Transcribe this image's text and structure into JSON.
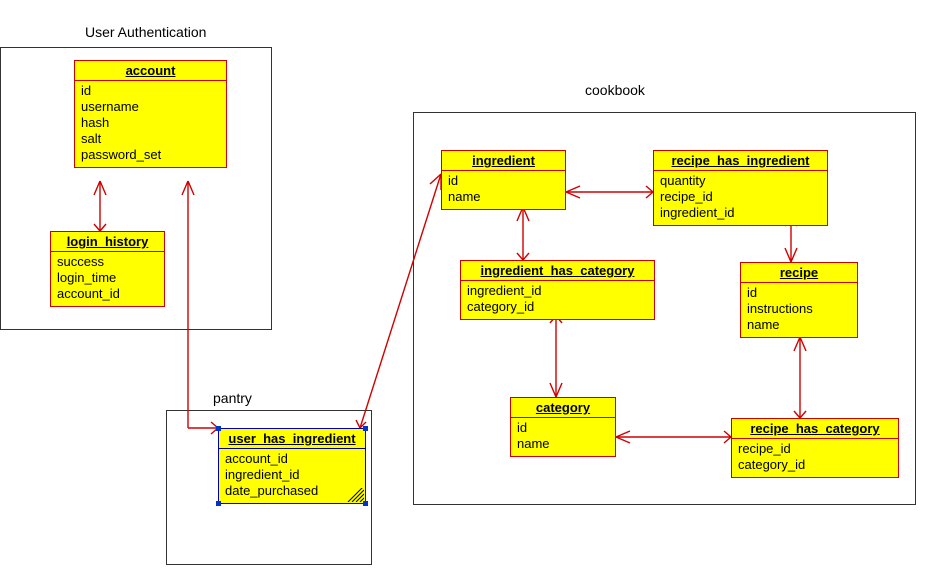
{
  "regions": {
    "auth": {
      "label": "User Authentication"
    },
    "pantry": {
      "label": "pantry"
    },
    "cookbook": {
      "label": "cookbook"
    }
  },
  "entities": {
    "account": {
      "title": "account",
      "fields": [
        "id",
        "username",
        "hash",
        "salt",
        "password_set"
      ]
    },
    "login_history": {
      "title": "login_history",
      "fields": [
        "success",
        "login_time",
        "account_id"
      ]
    },
    "user_has_ingredient": {
      "title": "user_has_ingredient",
      "fields": [
        "account_id",
        "ingredient_id",
        "date_purchased"
      ],
      "selected": true
    },
    "ingredient": {
      "title": "ingredient",
      "fields": [
        "id",
        "name"
      ]
    },
    "recipe_has_ingredient": {
      "title": "recipe_has_ingredient",
      "fields": [
        "quantity",
        "recipe_id",
        "ingredient_id"
      ]
    },
    "ingredient_has_category": {
      "title": "ingredient_has_category",
      "fields": [
        "ingredient_id",
        "category_id"
      ]
    },
    "recipe": {
      "title": "recipe",
      "fields": [
        "id",
        "instructions",
        "name"
      ]
    },
    "category": {
      "title": "category",
      "fields": [
        "id",
        "name"
      ]
    },
    "recipe_has_category": {
      "title": "recipe_has_category",
      "fields": [
        "recipe_id",
        "category_id"
      ]
    }
  },
  "relationships": [
    {
      "from": "account",
      "to": "login_history",
      "type": "one-to-many"
    },
    {
      "from": "account",
      "to": "user_has_ingredient",
      "type": "one-to-many"
    },
    {
      "from": "ingredient",
      "to": "user_has_ingredient",
      "type": "one-to-many"
    },
    {
      "from": "ingredient",
      "to": "recipe_has_ingredient",
      "type": "one-to-many"
    },
    {
      "from": "ingredient",
      "to": "ingredient_has_category",
      "type": "one-to-many"
    },
    {
      "from": "recipe",
      "to": "recipe_has_ingredient",
      "type": "one-to-many"
    },
    {
      "from": "recipe",
      "to": "recipe_has_category",
      "type": "one-to-many"
    },
    {
      "from": "category",
      "to": "ingredient_has_category",
      "type": "one-to-many"
    },
    {
      "from": "category",
      "to": "recipe_has_category",
      "type": "one-to-many"
    }
  ],
  "chart_data": {
    "type": "er-diagram",
    "entities": [
      {
        "name": "account",
        "attributes": [
          "id",
          "username",
          "hash",
          "salt",
          "password_set"
        ],
        "group": "User Authentication"
      },
      {
        "name": "login_history",
        "attributes": [
          "success",
          "login_time",
          "account_id"
        ],
        "group": "User Authentication"
      },
      {
        "name": "user_has_ingredient",
        "attributes": [
          "account_id",
          "ingredient_id",
          "date_purchased"
        ],
        "group": "pantry"
      },
      {
        "name": "ingredient",
        "attributes": [
          "id",
          "name"
        ],
        "group": "cookbook"
      },
      {
        "name": "recipe_has_ingredient",
        "attributes": [
          "quantity",
          "recipe_id",
          "ingredient_id"
        ],
        "group": "cookbook"
      },
      {
        "name": "ingredient_has_category",
        "attributes": [
          "ingredient_id",
          "category_id"
        ],
        "group": "cookbook"
      },
      {
        "name": "recipe",
        "attributes": [
          "id",
          "instructions",
          "name"
        ],
        "group": "cookbook"
      },
      {
        "name": "category",
        "attributes": [
          "id",
          "name"
        ],
        "group": "cookbook"
      },
      {
        "name": "recipe_has_category",
        "attributes": [
          "recipe_id",
          "category_id"
        ],
        "group": "cookbook"
      }
    ],
    "relationships": [
      {
        "parent": "account",
        "child": "login_history"
      },
      {
        "parent": "account",
        "child": "user_has_ingredient"
      },
      {
        "parent": "ingredient",
        "child": "user_has_ingredient"
      },
      {
        "parent": "ingredient",
        "child": "recipe_has_ingredient"
      },
      {
        "parent": "ingredient",
        "child": "ingredient_has_category"
      },
      {
        "parent": "recipe",
        "child": "recipe_has_ingredient"
      },
      {
        "parent": "recipe",
        "child": "recipe_has_category"
      },
      {
        "parent": "category",
        "child": "ingredient_has_category"
      },
      {
        "parent": "category",
        "child": "recipe_has_category"
      }
    ]
  }
}
